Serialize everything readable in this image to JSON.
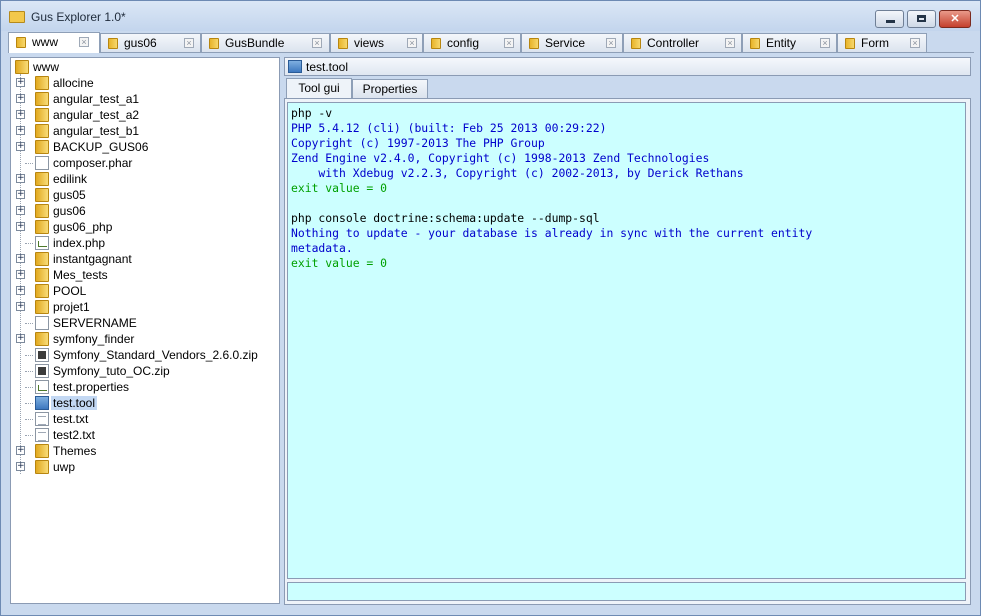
{
  "window": {
    "title": "Gus Explorer 1.0*",
    "minimize_label": "",
    "maximize_label": "",
    "close_label": "✕"
  },
  "tabs": [
    {
      "label": "www",
      "active": true
    },
    {
      "label": "gus06"
    },
    {
      "label": "GusBundle"
    },
    {
      "label": "views"
    },
    {
      "label": "config"
    },
    {
      "label": "Service"
    },
    {
      "label": "Controller"
    },
    {
      "label": "Entity"
    },
    {
      "label": "Form"
    }
  ],
  "tab_close_glyph": "×",
  "tree": {
    "root": "www",
    "expand_glyph": "+",
    "items": [
      {
        "name": "allocine",
        "type": "folder",
        "expandable": true
      },
      {
        "name": "angular_test_a1",
        "type": "folder",
        "expandable": true
      },
      {
        "name": "angular_test_a2",
        "type": "folder",
        "expandable": true
      },
      {
        "name": "angular_test_b1",
        "type": "folder",
        "expandable": true
      },
      {
        "name": "BACKUP_GUS06",
        "type": "folder",
        "expandable": true
      },
      {
        "name": "composer.phar",
        "type": "file"
      },
      {
        "name": "edilink",
        "type": "folder",
        "expandable": true
      },
      {
        "name": "gus05",
        "type": "folder",
        "expandable": true
      },
      {
        "name": "gus06",
        "type": "folder",
        "expandable": true
      },
      {
        "name": "gus06_php",
        "type": "folder",
        "expandable": true
      },
      {
        "name": "index.php",
        "type": "script"
      },
      {
        "name": "instantgagnant",
        "type": "folder",
        "expandable": true
      },
      {
        "name": "Mes_tests",
        "type": "folder",
        "expandable": true
      },
      {
        "name": "POOL",
        "type": "folder",
        "expandable": true
      },
      {
        "name": "projet1",
        "type": "folder",
        "expandable": true
      },
      {
        "name": "SERVERNAME",
        "type": "file"
      },
      {
        "name": "symfony_finder",
        "type": "folder",
        "expandable": true
      },
      {
        "name": "Symfony_Standard_Vendors_2.6.0.zip",
        "type": "zip"
      },
      {
        "name": "Symfony_tuto_OC.zip",
        "type": "zip"
      },
      {
        "name": "test.properties",
        "type": "script"
      },
      {
        "name": "test.tool",
        "type": "tool",
        "selected": true
      },
      {
        "name": "test.txt",
        "type": "text"
      },
      {
        "name": "test2.txt",
        "type": "text"
      },
      {
        "name": "Themes",
        "type": "folder",
        "expandable": true
      },
      {
        "name": "uwp",
        "type": "folder",
        "expandable": true
      }
    ]
  },
  "editor": {
    "file_name": "test.tool",
    "subtabs": [
      {
        "label": "Tool gui",
        "active": true
      },
      {
        "label": "Properties"
      }
    ],
    "console_lines": [
      {
        "kind": "cmd",
        "text": "php -v"
      },
      {
        "kind": "out",
        "text": "PHP 5.4.12 (cli) (built: Feb 25 2013 00:29:22)"
      },
      {
        "kind": "out",
        "text": "Copyright (c) 1997-2013 The PHP Group"
      },
      {
        "kind": "out",
        "text": "Zend Engine v2.4.0, Copyright (c) 1998-2013 Zend Technologies"
      },
      {
        "kind": "out",
        "text": "    with Xdebug v2.2.3, Copyright (c) 2002-2013, by Derick Rethans"
      },
      {
        "kind": "exit",
        "text": "exit value = 0"
      },
      {
        "kind": "cmd",
        "text": ""
      },
      {
        "kind": "cmd",
        "text": "php console doctrine:schema:update --dump-sql"
      },
      {
        "kind": "out",
        "text": "Nothing to update - your database is already in sync with the current entity"
      },
      {
        "kind": "out",
        "text": "metadata."
      },
      {
        "kind": "exit",
        "text": "exit value = 0"
      }
    ],
    "command_input_value": ""
  },
  "colors": {
    "console_bg": "#ccffff",
    "cmd_text": "#000000",
    "output_text": "#0000cc",
    "exit_text": "#00a000"
  }
}
